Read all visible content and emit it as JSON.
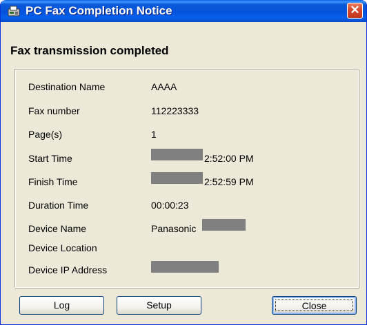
{
  "window": {
    "title": "PC Fax Completion Notice",
    "close_glyph": "✕"
  },
  "heading": "Fax transmission completed",
  "details": {
    "destination_name": {
      "label": "Destination Name",
      "value": "AAAA"
    },
    "fax_number": {
      "label": "Fax number",
      "value": "112223333"
    },
    "pages": {
      "label": "Page(s)",
      "value": "1"
    },
    "start_time": {
      "label": "Start Time",
      "value": "2:52:00 PM"
    },
    "finish_time": {
      "label": "Finish Time",
      "value": "2:52:59 PM"
    },
    "duration_time": {
      "label": "Duration Time",
      "value": "00:00:23"
    },
    "device_name": {
      "label": "Device Name",
      "value": "Panasonic"
    },
    "device_location": {
      "label": "Device Location",
      "value": ""
    },
    "device_ip": {
      "label": "Device IP Address",
      "value": ""
    }
  },
  "buttons": {
    "log": "Log",
    "setup": "Setup",
    "close": "Close"
  },
  "colors": {
    "titlebar": "#0553db",
    "window_bg": "#ece9d8",
    "redaction": "#808080",
    "close_button": "#d4472b"
  },
  "icons": {
    "app": "fax-icon",
    "close": "close-icon"
  }
}
